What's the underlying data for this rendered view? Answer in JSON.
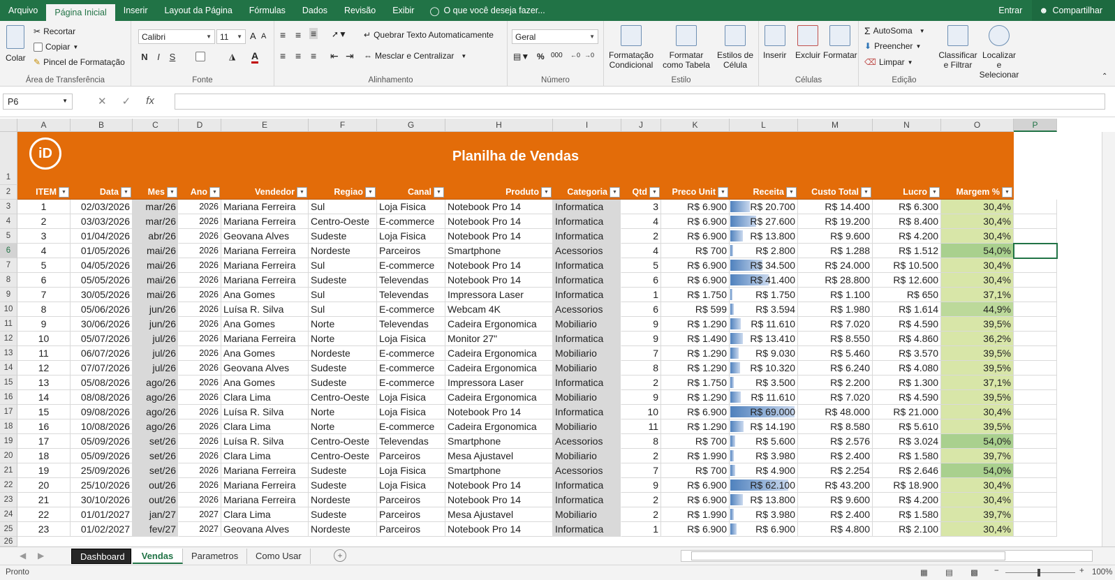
{
  "menu": {
    "tabs": [
      "Arquivo",
      "Página Inicial",
      "Inserir",
      "Layout da Página",
      "Fórmulas",
      "Dados",
      "Revisão",
      "Exibir"
    ],
    "tell_me": "O que você deseja fazer...",
    "sign_in": "Entrar",
    "share": "Compartilhar"
  },
  "ribbon": {
    "clipboard": {
      "paste": "Colar",
      "cut": "Recortar",
      "copy": "Copiar",
      "painter": "Pincel de Formatação",
      "label": "Área de Transferência"
    },
    "font": {
      "name": "Calibri",
      "size": "11",
      "bold": "N",
      "italic": "I",
      "underline": "S",
      "label": "Fonte"
    },
    "alignment": {
      "wrap": "Quebrar Texto Automaticamente",
      "merge": "Mesclar e Centralizar",
      "label": "Alinhamento"
    },
    "number": {
      "format": "Geral",
      "label": "Número"
    },
    "styles": {
      "cond": "Formatação Condicional",
      "table": "Formatar como Tabela",
      "cell": "Estilos de Célula",
      "label": "Estilo"
    },
    "cells": {
      "insert": "Inserir",
      "delete": "Excluir",
      "format": "Formatar",
      "label": "Células"
    },
    "editing": {
      "autosum": "AutoSoma",
      "fill": "Preencher",
      "clear": "Limpar",
      "sort": "Classificar e Filtrar",
      "find": "Localizar e Selecionar",
      "label": "Edição"
    }
  },
  "formula_bar": {
    "name_box": "P6",
    "value": ""
  },
  "columns": [
    "A",
    "B",
    "C",
    "D",
    "E",
    "F",
    "G",
    "H",
    "I",
    "J",
    "K",
    "L",
    "M",
    "N",
    "O",
    "P"
  ],
  "sheet": {
    "title": "Planilha de Vendas",
    "logo": "iD",
    "headers": [
      "ITEM",
      "Data",
      "Mes",
      "Ano",
      "Vendedor",
      "Regiao",
      "Canal",
      "Produto",
      "Categoria",
      "Qtd",
      "Preco Unit",
      "Receita",
      "Custo Total",
      "Lucro",
      "Margem %"
    ],
    "rows": [
      [
        "1",
        "02/03/2026",
        "mar/26",
        "2026",
        "Mariana Ferreira",
        "Sul",
        "Loja Fisica",
        "Notebook Pro 14",
        "Informatica",
        "3",
        "R$ 6.900",
        "R$ 20.700",
        "R$ 14.400",
        "R$ 6.300",
        "30,4%"
      ],
      [
        "2",
        "03/03/2026",
        "mar/26",
        "2026",
        "Mariana Ferreira",
        "Centro-Oeste",
        "E-commerce",
        "Notebook Pro 14",
        "Informatica",
        "4",
        "R$ 6.900",
        "R$ 27.600",
        "R$ 19.200",
        "R$ 8.400",
        "30,4%"
      ],
      [
        "3",
        "01/04/2026",
        "abr/26",
        "2026",
        "Geovana Alves",
        "Sudeste",
        "Loja Fisica",
        "Notebook Pro 14",
        "Informatica",
        "2",
        "R$ 6.900",
        "R$ 13.800",
        "R$ 9.600",
        "R$ 4.200",
        "30,4%"
      ],
      [
        "4",
        "01/05/2026",
        "mai/26",
        "2026",
        "Mariana Ferreira",
        "Nordeste",
        "Parceiros",
        "Smartphone",
        "Acessorios",
        "4",
        "R$ 700",
        "R$ 2.800",
        "R$ 1.288",
        "R$ 1.512",
        "54,0%"
      ],
      [
        "5",
        "04/05/2026",
        "mai/26",
        "2026",
        "Mariana Ferreira",
        "Sul",
        "E-commerce",
        "Notebook Pro 14",
        "Informatica",
        "5",
        "R$ 6.900",
        "R$ 34.500",
        "R$ 24.000",
        "R$ 10.500",
        "30,4%"
      ],
      [
        "6",
        "05/05/2026",
        "mai/26",
        "2026",
        "Mariana Ferreira",
        "Sudeste",
        "Televendas",
        "Notebook Pro 14",
        "Informatica",
        "6",
        "R$ 6.900",
        "R$ 41.400",
        "R$ 28.800",
        "R$ 12.600",
        "30,4%"
      ],
      [
        "7",
        "30/05/2026",
        "mai/26",
        "2026",
        "Ana Gomes",
        "Sul",
        "Televendas",
        "Impressora Laser",
        "Informatica",
        "1",
        "R$ 1.750",
        "R$ 1.750",
        "R$ 1.100",
        "R$ 650",
        "37,1%"
      ],
      [
        "8",
        "05/06/2026",
        "jun/26",
        "2026",
        "Luísa R. Silva",
        "Sul",
        "E-commerce",
        "Webcam 4K",
        "Acessorios",
        "6",
        "R$ 599",
        "R$ 3.594",
        "R$ 1.980",
        "R$ 1.614",
        "44,9%"
      ],
      [
        "9",
        "30/06/2026",
        "jun/26",
        "2026",
        "Ana Gomes",
        "Norte",
        "Televendas",
        "Cadeira Ergonomica",
        "Mobiliario",
        "9",
        "R$ 1.290",
        "R$ 11.610",
        "R$ 7.020",
        "R$ 4.590",
        "39,5%"
      ],
      [
        "10",
        "05/07/2026",
        "jul/26",
        "2026",
        "Mariana Ferreira",
        "Norte",
        "Loja Fisica",
        "Monitor 27\"",
        "Informatica",
        "9",
        "R$ 1.490",
        "R$ 13.410",
        "R$ 8.550",
        "R$ 4.860",
        "36,2%"
      ],
      [
        "11",
        "06/07/2026",
        "jul/26",
        "2026",
        "Ana Gomes",
        "Nordeste",
        "E-commerce",
        "Cadeira Ergonomica",
        "Mobiliario",
        "7",
        "R$ 1.290",
        "R$ 9.030",
        "R$ 5.460",
        "R$ 3.570",
        "39,5%"
      ],
      [
        "12",
        "07/07/2026",
        "jul/26",
        "2026",
        "Geovana Alves",
        "Sudeste",
        "E-commerce",
        "Cadeira Ergonomica",
        "Mobiliario",
        "8",
        "R$ 1.290",
        "R$ 10.320",
        "R$ 6.240",
        "R$ 4.080",
        "39,5%"
      ],
      [
        "13",
        "05/08/2026",
        "ago/26",
        "2026",
        "Ana Gomes",
        "Sudeste",
        "E-commerce",
        "Impressora Laser",
        "Informatica",
        "2",
        "R$ 1.750",
        "R$ 3.500",
        "R$ 2.200",
        "R$ 1.300",
        "37,1%"
      ],
      [
        "14",
        "08/08/2026",
        "ago/26",
        "2026",
        "Clara Lima",
        "Centro-Oeste",
        "Loja Fisica",
        "Cadeira Ergonomica",
        "Mobiliario",
        "9",
        "R$ 1.290",
        "R$ 11.610",
        "R$ 7.020",
        "R$ 4.590",
        "39,5%"
      ],
      [
        "15",
        "09/08/2026",
        "ago/26",
        "2026",
        "Luísa R. Silva",
        "Norte",
        "Loja Fisica",
        "Notebook Pro 14",
        "Informatica",
        "10",
        "R$ 6.900",
        "R$ 69.000",
        "R$ 48.000",
        "R$ 21.000",
        "30,4%"
      ],
      [
        "16",
        "10/08/2026",
        "ago/26",
        "2026",
        "Clara Lima",
        "Norte",
        "E-commerce",
        "Cadeira Ergonomica",
        "Mobiliario",
        "11",
        "R$ 1.290",
        "R$ 14.190",
        "R$ 8.580",
        "R$ 5.610",
        "39,5%"
      ],
      [
        "17",
        "05/09/2026",
        "set/26",
        "2026",
        "Luísa R. Silva",
        "Centro-Oeste",
        "Televendas",
        "Smartphone",
        "Acessorios",
        "8",
        "R$ 700",
        "R$ 5.600",
        "R$ 2.576",
        "R$ 3.024",
        "54,0%"
      ],
      [
        "18",
        "05/09/2026",
        "set/26",
        "2026",
        "Clara Lima",
        "Centro-Oeste",
        "Parceiros",
        "Mesa Ajustavel",
        "Mobiliario",
        "2",
        "R$ 1.990",
        "R$ 3.980",
        "R$ 2.400",
        "R$ 1.580",
        "39,7%"
      ],
      [
        "19",
        "25/09/2026",
        "set/26",
        "2026",
        "Mariana Ferreira",
        "Sudeste",
        "Loja Fisica",
        "Smartphone",
        "Acessorios",
        "7",
        "R$ 700",
        "R$ 4.900",
        "R$ 2.254",
        "R$ 2.646",
        "54,0%"
      ],
      [
        "20",
        "25/10/2026",
        "out/26",
        "2026",
        "Mariana Ferreira",
        "Sudeste",
        "Loja Fisica",
        "Notebook Pro 14",
        "Informatica",
        "9",
        "R$ 6.900",
        "R$ 62.100",
        "R$ 43.200",
        "R$ 18.900",
        "30,4%"
      ],
      [
        "21",
        "30/10/2026",
        "out/26",
        "2026",
        "Mariana Ferreira",
        "Nordeste",
        "Parceiros",
        "Notebook Pro 14",
        "Informatica",
        "2",
        "R$ 6.900",
        "R$ 13.800",
        "R$ 9.600",
        "R$ 4.200",
        "30,4%"
      ],
      [
        "22",
        "01/01/2027",
        "jan/27",
        "2027",
        "Clara Lima",
        "Sudeste",
        "Parceiros",
        "Mesa Ajustavel",
        "Mobiliario",
        "2",
        "R$ 1.990",
        "R$ 3.980",
        "R$ 2.400",
        "R$ 1.580",
        "39,7%"
      ],
      [
        "23",
        "01/02/2027",
        "fev/27",
        "2027",
        "Geovana Alves",
        "Nordeste",
        "Parceiros",
        "Notebook Pro 14",
        "Informatica",
        "1",
        "R$ 6.900",
        "R$ 6.900",
        "R$ 4.800",
        "R$ 2.100",
        "30,4%"
      ]
    ],
    "receita_values": [
      20700,
      27600,
      13800,
      2800,
      34500,
      41400,
      1750,
      3594,
      11610,
      13410,
      9030,
      10320,
      3500,
      11610,
      69000,
      14190,
      5600,
      3980,
      4900,
      62100,
      13800,
      3980,
      6900
    ],
    "selected_row": 6
  },
  "sheet_tabs": [
    "Dashboard",
    "Vendas",
    "Parametros",
    "Como Usar"
  ],
  "status": {
    "ready": "Pronto",
    "zoom": "100%"
  },
  "colors": {
    "accent": "#217346",
    "banner": "#e36c09",
    "databar": "#4f81bd",
    "margin_low": "#d8e6a8",
    "margin_high": "#a9d08e"
  }
}
